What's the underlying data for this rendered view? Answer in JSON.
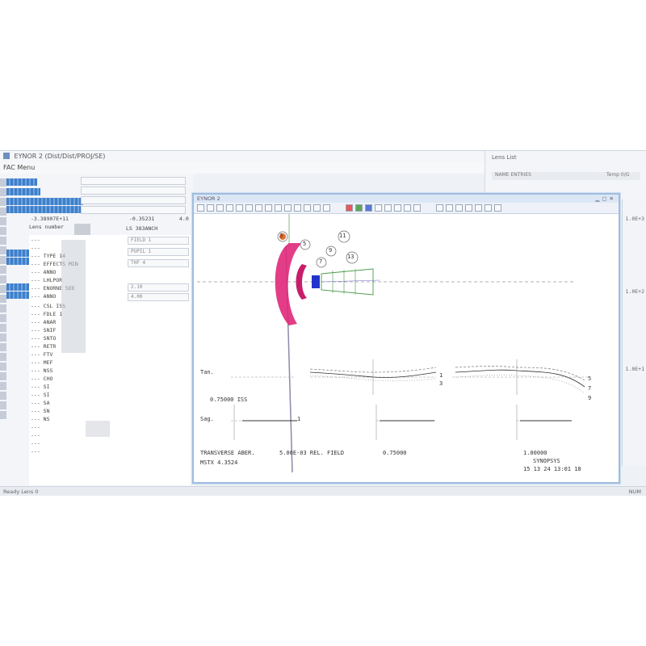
{
  "app": {
    "title": "EYNOR 2  (Dist/Dist/PROJ/SE)",
    "menu": "FAC Menu",
    "right_panel_title": "Lens List",
    "right_panel_row_a": "NAME  ENTRIES",
    "right_panel_row_b": "Temp 0/G"
  },
  "left_pane": {
    "header_value_a": "-3.38907E+11",
    "header_value_b": "-0.35231",
    "header_value_c": "4.0",
    "lens_number_label": "Lens number",
    "lens_label": "LS 383ANCH",
    "field_labels": [
      "FIELD 1",
      "PUPIL 1",
      "THF 4",
      "2.10",
      "4.00"
    ],
    "lines": [
      "---",
      "---",
      "--- TYPE 14",
      "---  EFFECTS MIN",
      "---  ANNO",
      "---  LHLPOR",
      "---  ENORNE SEE",
      "---  ANNO",
      "--- CSL ISS",
      "--- FDLE 1",
      "--- ANAR",
      "--- SNIF",
      "--- SNTO",
      "--- RETR",
      "--- FTV",
      "--- MEF",
      "--- NSS",
      "--- CHO",
      "--- SI",
      "--- SI",
      "--- SA",
      "--- SN",
      "--- NS",
      "---",
      "---",
      "---",
      "---"
    ]
  },
  "plot_window": {
    "title": "EYNOR 2",
    "tan_label": "Tan.",
    "sag_label": "Sag.",
    "field_value": "0.75000  ISS",
    "bottom_left_line1": "TRANSVERSE ABER.",
    "bottom_left_line2": "MSTX  4.3524",
    "rel_field_label": "5.00E-03  REL. FIELD",
    "rel_field_mid": "0.75000",
    "rel_field_right": "1.00000",
    "logo_line1": "SYNOPSYS",
    "logo_line2": "15 13 24  13:01  18",
    "surface_labels": [
      "3",
      "5",
      "7",
      "9",
      "11",
      "13"
    ],
    "curve_marks_a": [
      "1",
      "3"
    ],
    "curve_marks_b": [
      "5",
      "7",
      "9"
    ],
    "sag_marks": [
      "1"
    ]
  },
  "right_strip": {
    "labels": [
      "1.0E+3",
      "1.0E+2",
      "1.0E+1"
    ]
  },
  "statusbar": {
    "left": "Ready  Lens  0",
    "right": "NUM"
  }
}
